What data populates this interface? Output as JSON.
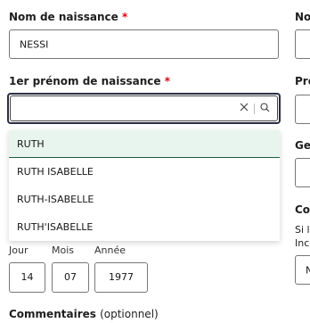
{
  "form": {
    "birth_name": {
      "label": "Nom de naissance",
      "required_mark": "*",
      "value": "NESSI"
    },
    "first_name": {
      "label": "1er prénom de naissance",
      "required_mark": "*",
      "value": "",
      "clear_icon": "close-icon",
      "search_icon": "search-icon",
      "options": [
        "RUTH",
        "RUTH ISABELLE",
        "RUTH-ISABELLE",
        "RUTH'ISABELLE"
      ],
      "highlighted_option": "RUTH"
    },
    "birth_date": {
      "day_label": "Jour",
      "day_value": "14",
      "month_label": "Mois",
      "month_value": "07",
      "year_label": "Année",
      "year_value": "1977"
    },
    "comments": {
      "label": "Commentaires",
      "optional_note": "(optionnel)"
    }
  },
  "right_column": {
    "label_1": "No",
    "label_2": "Pré",
    "label_3": "Ge",
    "label_4": "Co",
    "text_1": "Si l",
    "text_2": "Inc",
    "field_value": "N"
  },
  "colors": {
    "required": "#e1000f",
    "highlight": "#e8f5ef",
    "focus": "#2b2d42"
  }
}
